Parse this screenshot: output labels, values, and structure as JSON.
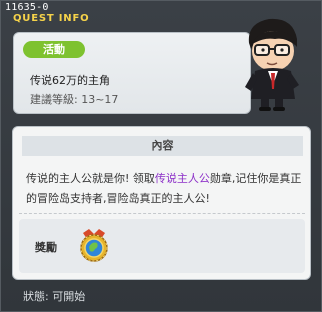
{
  "window": {
    "quest_id": "11635-0",
    "title": "QUEST INFO"
  },
  "quest": {
    "badge": "活動",
    "name": "传说62万的主角",
    "level_label": "建議等級:",
    "level_range": "13~17"
  },
  "content": {
    "header": "內容",
    "desc_part1": "传说的主人公就是你! 领取",
    "desc_highlight": "传说主人公",
    "desc_part2": "勋章,记住你是真正的冒险岛支持者,冒险岛真正的主人公!",
    "reward_label": "獎勵"
  },
  "status": {
    "label": "狀態:",
    "value": "可開始"
  },
  "colors": {
    "title": "#f6d34a",
    "badge": "#7ec22f",
    "highlight": "#8c2fc8"
  }
}
